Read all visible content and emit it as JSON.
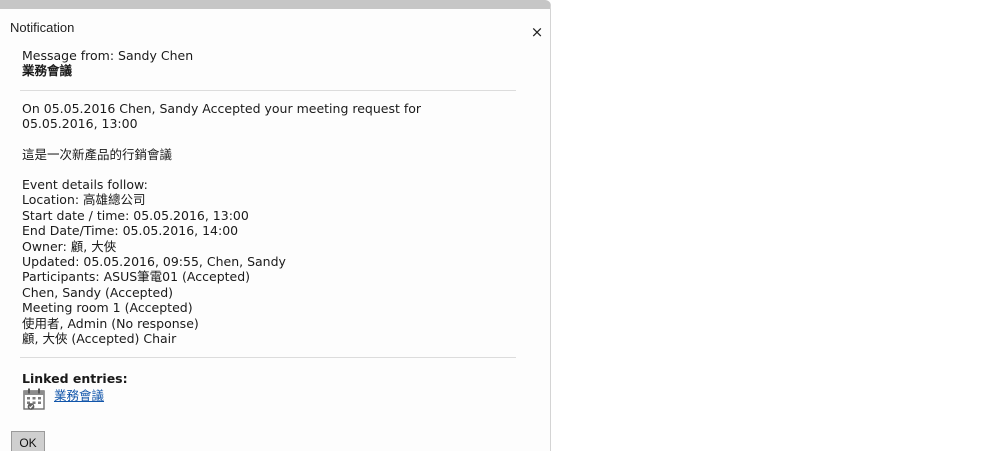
{
  "dialog": {
    "title": "Notification",
    "close_symbol": "×",
    "ok_label": "OK"
  },
  "message": {
    "from": "Message from: Sandy Chen",
    "subject": "業務會議",
    "summary": "On 05.05.2016 Chen, Sandy Accepted your meeting request for 05.05.2016, 13:00",
    "description": "這是一次新產品的行銷會議"
  },
  "event": {
    "heading": "Event details follow:",
    "location": "Location: 高雄總公司",
    "start": "Start date / time: 05.05.2016, 13:00",
    "end": "End Date/Time: 05.05.2016, 14:00",
    "owner": "Owner: 顧, 大俠",
    "updated": "Updated: 05.05.2016, 09:55, Chen, Sandy",
    "participants": [
      "Participants: ASUS筆電01 (Accepted)",
      "Chen, Sandy (Accepted)",
      "Meeting room 1 (Accepted)",
      "使用者, Admin (No response)",
      "顧, 大俠 (Accepted) Chair"
    ]
  },
  "linked": {
    "heading": "Linked entries:",
    "entries": [
      {
        "label": "業務會議",
        "icon": "calendar-icon"
      }
    ]
  },
  "colors": {
    "link": "#1155aa",
    "button_bg": "#cfcfcf",
    "header_bar": "#c6c6c6"
  }
}
